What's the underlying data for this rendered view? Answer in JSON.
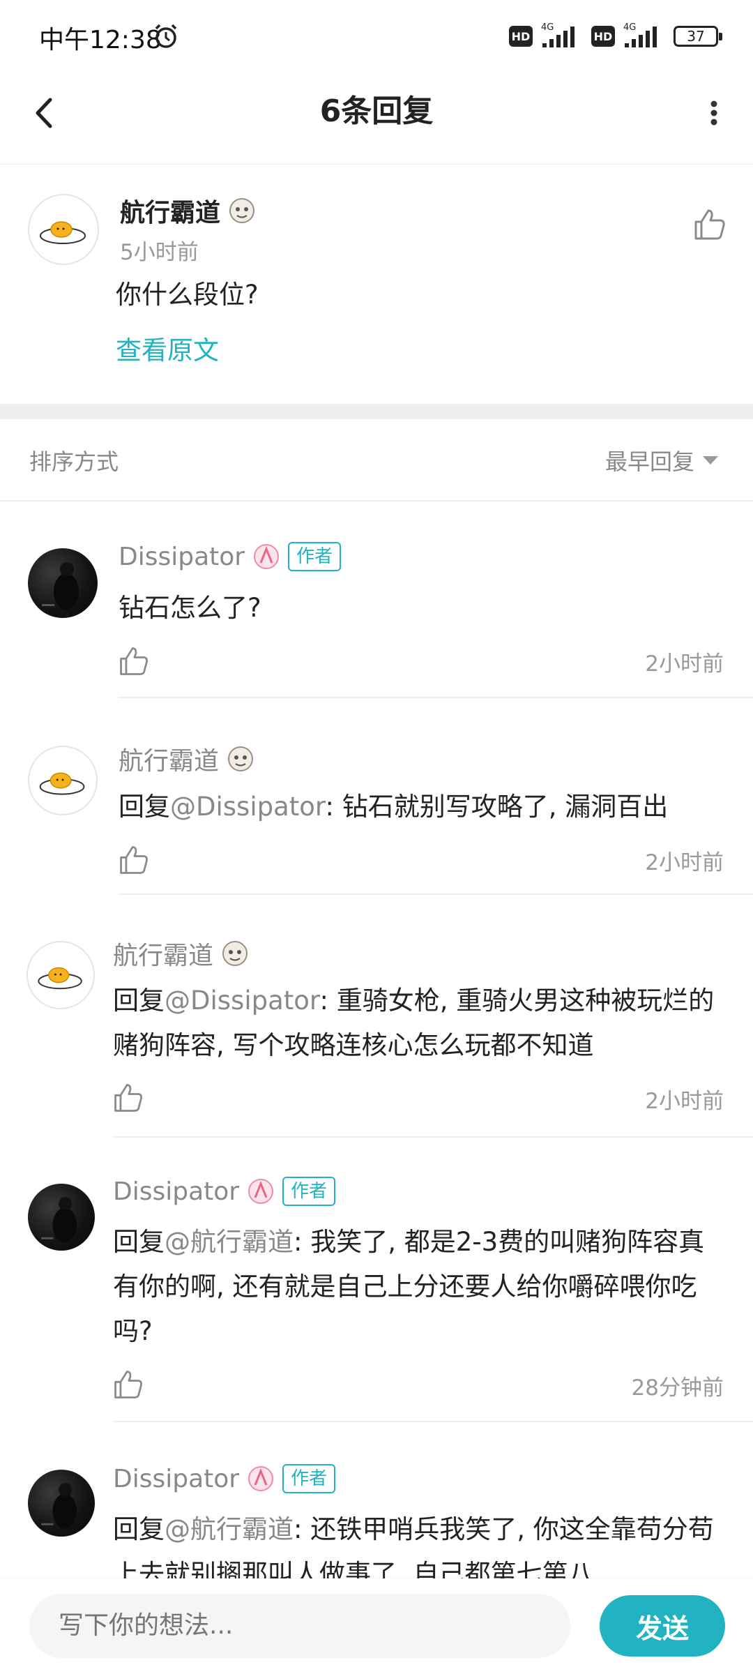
{
  "status_bar": {
    "time": "中午12:38",
    "network_1": "4G",
    "network_2": "4G",
    "hd": "HD",
    "battery": "37"
  },
  "nav": {
    "title": "6条回复"
  },
  "root_comment": {
    "username": "航行霸道",
    "time": "5小时前",
    "text": "你什么段位?",
    "view_original": "查看原文"
  },
  "sort": {
    "label": "排序方式",
    "value": "最早回复"
  },
  "replies": [
    {
      "username": "Dissipator",
      "is_author": true,
      "author_badge": "作者",
      "prefix": "",
      "mention": "",
      "text": "钻石怎么了?",
      "time": "2小时前"
    },
    {
      "username": "航行霸道",
      "is_author": false,
      "prefix": "回复",
      "mention": "@Dissipator",
      "text": ": 钻石就别写攻略了, 漏洞百出",
      "time": "2小时前"
    },
    {
      "username": "航行霸道",
      "is_author": false,
      "prefix": "回复",
      "mention": "@Dissipator",
      "text": ": 重骑女枪, 重骑火男这种被玩烂的赌狗阵容, 写个攻略连核心怎么玩都不知道",
      "time": "2小时前"
    },
    {
      "username": "Dissipator",
      "is_author": true,
      "author_badge": "作者",
      "prefix": "回复",
      "mention": "@航行霸道",
      "text": ": 我笑了, 都是2-3费的叫赌狗阵容真有你的啊, 还有就是自己上分还要人给你嚼碎喂你吃吗?",
      "time": "28分钟前"
    },
    {
      "username": "Dissipator",
      "is_author": true,
      "author_badge": "作者",
      "prefix": "回复",
      "mention": "@航行霸道",
      "text": ": 还铁甲哨兵我笑了, 你这全靠苟分苟上去就别搁那叫人做事了, 自己都第七第八",
      "time": ""
    }
  ],
  "input": {
    "placeholder": "写下你的想法...",
    "send_label": "发送"
  },
  "colors": {
    "accent": "#21b3c1",
    "muted_text": "#888888",
    "separator": "#eeeeee"
  },
  "icons": [
    "alarm-icon",
    "back-arrow-icon",
    "more-vertical-icon",
    "thumbs-up-icon",
    "dropdown-triangle-icon",
    "egg-avatar",
    "dark-avatar",
    "medal-icon"
  ]
}
